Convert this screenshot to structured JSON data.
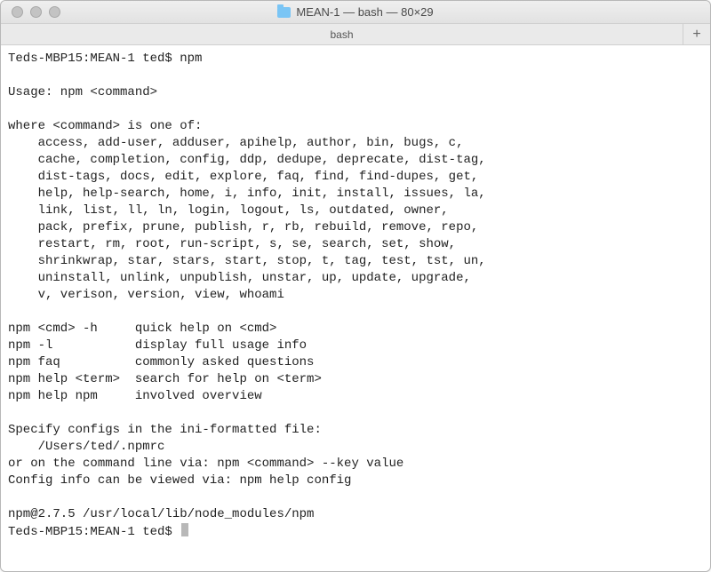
{
  "titlebar": {
    "folder_icon": "folder-icon",
    "title": "MEAN-1 — bash — 80×29"
  },
  "tabbar": {
    "active_tab": "bash",
    "new_tab": "+"
  },
  "terminal": {
    "lines": [
      "Teds-MBP15:MEAN-1 ted$ npm",
      "",
      "Usage: npm <command>",
      "",
      "where <command> is one of:",
      "    access, add-user, adduser, apihelp, author, bin, bugs, c,",
      "    cache, completion, config, ddp, dedupe, deprecate, dist-tag,",
      "    dist-tags, docs, edit, explore, faq, find, find-dupes, get,",
      "    help, help-search, home, i, info, init, install, issues, la,",
      "    link, list, ll, ln, login, logout, ls, outdated, owner,",
      "    pack, prefix, prune, publish, r, rb, rebuild, remove, repo,",
      "    restart, rm, root, run-script, s, se, search, set, show,",
      "    shrinkwrap, star, stars, start, stop, t, tag, test, tst, un,",
      "    uninstall, unlink, unpublish, unstar, up, update, upgrade,",
      "    v, verison, version, view, whoami",
      "",
      "npm <cmd> -h     quick help on <cmd>",
      "npm -l           display full usage info",
      "npm faq          commonly asked questions",
      "npm help <term>  search for help on <term>",
      "npm help npm     involved overview",
      "",
      "Specify configs in the ini-formatted file:",
      "    /Users/ted/.npmrc",
      "or on the command line via: npm <command> --key value",
      "Config info can be viewed via: npm help config",
      "",
      "npm@2.7.5 /usr/local/lib/node_modules/npm"
    ],
    "prompt": "Teds-MBP15:MEAN-1 ted$ "
  }
}
